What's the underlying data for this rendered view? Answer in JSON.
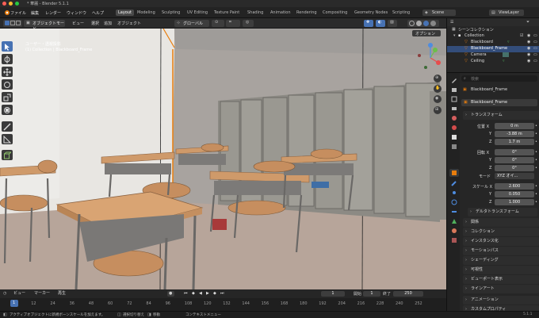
{
  "window": {
    "title": "* 華麗 - Blender 5.1.1"
  },
  "menubar": {
    "menus": [
      "ファイル",
      "編集",
      "レンダー",
      "ウィンドウ",
      "ヘルプ"
    ],
    "workspaces": [
      "Layout",
      "Modeling",
      "Sculpting",
      "UV Editing",
      "Texture Paint",
      "Shading",
      "Animation",
      "Rendering",
      "Compositing",
      "Geometry Nodes",
      "Scripting"
    ],
    "scene": "Scene",
    "view_layer": "ViewLayer"
  },
  "viewport_header": {
    "mode": "オブジェクトモード",
    "view": "ビュー",
    "select": "選択",
    "add": "追加",
    "object": "オブジェクト",
    "orientation": "グローバル",
    "options": "オプション"
  },
  "viewport": {
    "overlay_title": "ユーザー・透視投影",
    "overlay_sub": "(1) Collection | Blackboard_Frame",
    "gizmo_axes": [
      "X",
      "Y",
      "Z"
    ]
  },
  "outliner": {
    "header": "シーンコレクション",
    "rows": [
      "Collection",
      "Blackboard",
      "Blackboard_Frame",
      "Camera",
      "Ceiling"
    ]
  },
  "properties": {
    "search_placeholder": "検索",
    "object_name": "Blackboard_Frame",
    "object_name_field": "Blackboard_Frame",
    "transform_header": "トランスフォーム",
    "location_label": "位置 X",
    "location": {
      "x": "0 m",
      "y": "-3.88 m",
      "z": "1.7 m"
    },
    "rotation_label": "回転 X",
    "rotation": {
      "x": "0°",
      "y": "0°",
      "z": "0°"
    },
    "mode_label": "モード",
    "mode_value": "XYZ オイ...",
    "scale_label": "スケール X",
    "scale": {
      "x": "2.600",
      "y": "0.050",
      "z": "1.000"
    },
    "axis_y": "Y",
    "axis_z": "Z",
    "delta_transform": "デルタトランスフォーム",
    "panels": [
      "関係",
      "コレクション",
      "インスタンス化",
      "モーションパス",
      "シェーディング",
      "可視性",
      "ビューポート表示",
      "ラインアート",
      "アニメーション",
      "カスタムプロパティ"
    ]
  },
  "timeline": {
    "menus": [
      "ビュー",
      "マーカー",
      "再生"
    ],
    "current_frame": "1",
    "start_label": "開始",
    "start": "1",
    "end_label": "終了",
    "end": "250",
    "ticks": [
      "1",
      "12",
      "24",
      "36",
      "48",
      "60",
      "72",
      "84",
      "96",
      "108",
      "120",
      "132",
      "144",
      "156",
      "168",
      "180",
      "192",
      "204",
      "216",
      "228",
      "240",
      "252"
    ]
  },
  "statusbar": {
    "left": "アクティブオブジェクトに新規ボーンスケールを加えます。",
    "select": "選択切り替え",
    "move": "移動",
    "context": "コンテキストメニュー",
    "version": "5.1.1"
  },
  "colors": {
    "accent": "#4772b3",
    "selected": "#e87d0d",
    "bg": "#1d1d1d"
  }
}
